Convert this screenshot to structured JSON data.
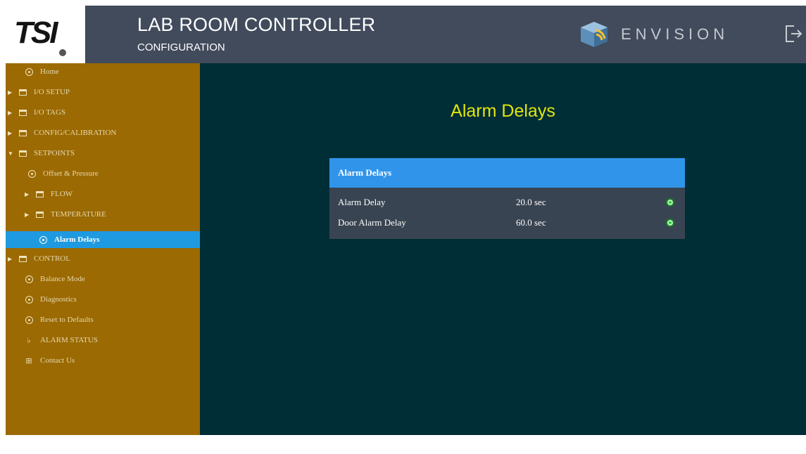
{
  "header": {
    "logo_text": "TSI",
    "title": "LAB ROOM CONTROLLER",
    "subtitle": "CONFIGURATION",
    "brand": "ENVISION",
    "colors": {
      "header_bg": "#414b5c",
      "sidebar_bg": "#9b6a02",
      "main_bg": "#002e36",
      "active": "#1f9ae0",
      "title_accent": "#e3e60c",
      "status_ok": "#2ecc3a"
    }
  },
  "sidebar": {
    "items": [
      {
        "label": "Home",
        "icon": "home-circle-icon"
      },
      {
        "label": "I/O SETUP",
        "icon": "folder-icon"
      },
      {
        "label": "I/O TAGS",
        "icon": "folder-icon"
      },
      {
        "label": "CONFIG/CALIBRATION",
        "icon": "folder-icon"
      },
      {
        "label": "SETPOINTS",
        "icon": "folder-icon"
      },
      {
        "label": "Offset & Pressure",
        "icon": "circle-icon"
      },
      {
        "label": "FLOW",
        "icon": "folder-icon"
      },
      {
        "label": "TEMPERATURE",
        "icon": "folder-icon"
      },
      {
        "label": "Alarm Delays",
        "icon": "circle-icon"
      },
      {
        "label": "CONTROL",
        "icon": "folder-icon"
      },
      {
        "label": "Balance Mode",
        "icon": "circle-icon"
      },
      {
        "label": "Diagnostics",
        "icon": "circle-icon"
      },
      {
        "label": "Reset to Defaults",
        "icon": "circle-icon"
      },
      {
        "label": "ALARM STATUS",
        "icon": "bell-icon"
      },
      {
        "label": "Contact Us",
        "icon": "grid-icon"
      }
    ]
  },
  "main": {
    "page_title": "Alarm Delays",
    "panel": {
      "header": "Alarm Delays",
      "rows": [
        {
          "label": "Alarm Delay",
          "value": "20.0 sec",
          "status": "ok"
        },
        {
          "label": "Door Alarm Delay",
          "value": "60.0 sec",
          "status": "ok"
        }
      ]
    }
  }
}
